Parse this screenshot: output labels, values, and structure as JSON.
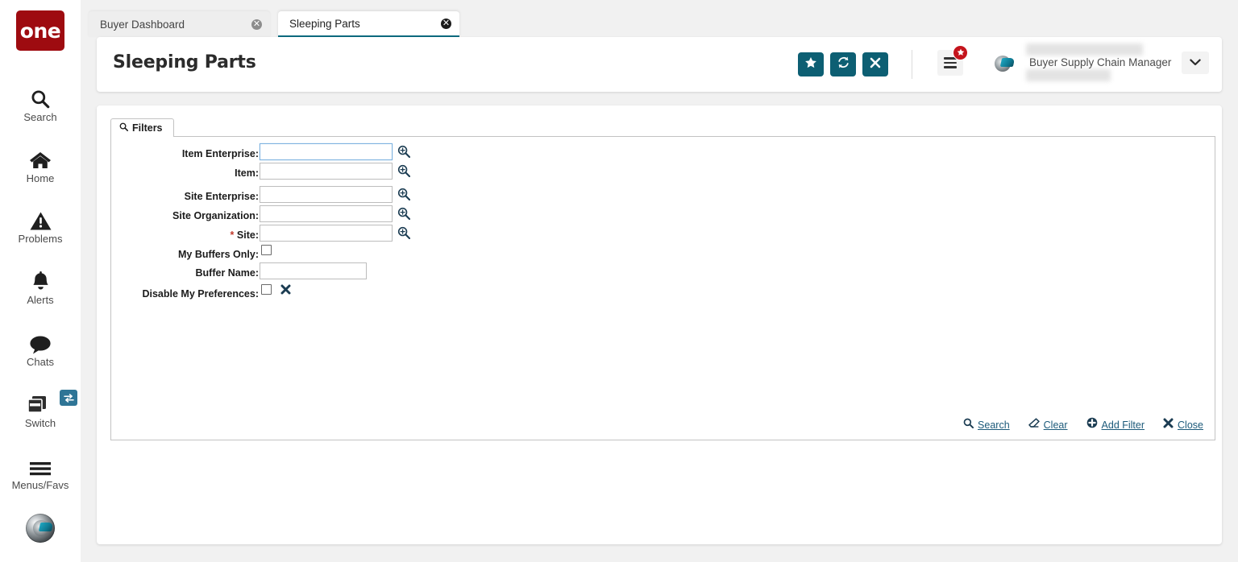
{
  "app": {
    "logo_text": "one",
    "brand_color": "#9e0b10",
    "accent_color": "#0d5f73",
    "link_color": "#1c5a7a"
  },
  "sidebar": {
    "items": [
      {
        "label": "Search",
        "icon": "search-icon"
      },
      {
        "label": "Home",
        "icon": "home-icon"
      },
      {
        "label": "Problems",
        "icon": "warning-triangle-icon"
      },
      {
        "label": "Alerts",
        "icon": "bell-icon"
      },
      {
        "label": "Chats",
        "icon": "chat-bubble-icon"
      },
      {
        "label": "Switch",
        "icon": "windows-stack-icon",
        "badge_icon": "swap-arrows-icon"
      },
      {
        "label": "Menus/Favs",
        "icon": "hamburger-icon"
      }
    ],
    "avatar_icon": "user-avatar-icon"
  },
  "tabs": [
    {
      "label": "Buyer Dashboard",
      "active": false,
      "close_icon": "close-circle-icon"
    },
    {
      "label": "Sleeping Parts",
      "active": true,
      "close_icon": "close-circle-icon"
    }
  ],
  "header": {
    "title": "Sleeping Parts",
    "buttons": [
      {
        "name": "favorite-button",
        "icon": "star-icon"
      },
      {
        "name": "refresh-button",
        "icon": "refresh-icon"
      },
      {
        "name": "close-button",
        "icon": "x-icon"
      }
    ],
    "menu_icon": "hamburger-icon",
    "menu_badge_icon": "star-icon",
    "avatar_icon": "user-avatar-icon",
    "role": "Buyer Supply Chain Manager",
    "caret_icon": "chevron-down-icon"
  },
  "filters": {
    "tab_label": "Filters",
    "tab_icon": "search-icon",
    "fields": [
      {
        "label": "Item Enterprise:",
        "type": "text",
        "value": "",
        "lookup": true,
        "required": false,
        "focused": true
      },
      {
        "label": "Item:",
        "type": "text",
        "value": "",
        "lookup": true,
        "required": false,
        "focused": false
      },
      {
        "label": "Site Enterprise:",
        "type": "text",
        "value": "",
        "lookup": true,
        "required": false,
        "focused": false
      },
      {
        "label": "Site Organization:",
        "type": "text",
        "value": "",
        "lookup": true,
        "required": false,
        "focused": false
      },
      {
        "label": "Site:",
        "type": "text",
        "value": "",
        "lookup": true,
        "required": true,
        "focused": false
      },
      {
        "label": "My Buffers Only:",
        "type": "checkbox",
        "value": "",
        "lookup": false,
        "required": false,
        "checked": false
      },
      {
        "label": "Buffer Name:",
        "type": "text",
        "value": "",
        "lookup": false,
        "required": false,
        "focused": false
      },
      {
        "label": "Disable My Preferences:",
        "type": "checkbox",
        "value": "",
        "lookup": false,
        "required": false,
        "checked": false,
        "clear_icon": "x-bold-icon"
      }
    ],
    "actions": [
      {
        "label": "Search",
        "icon": "search-icon"
      },
      {
        "label": "Clear",
        "icon": "eraser-icon"
      },
      {
        "label": "Add Filter",
        "icon": "plus-circle-icon"
      },
      {
        "label": "Close",
        "icon": "x-bold-icon"
      }
    ]
  }
}
